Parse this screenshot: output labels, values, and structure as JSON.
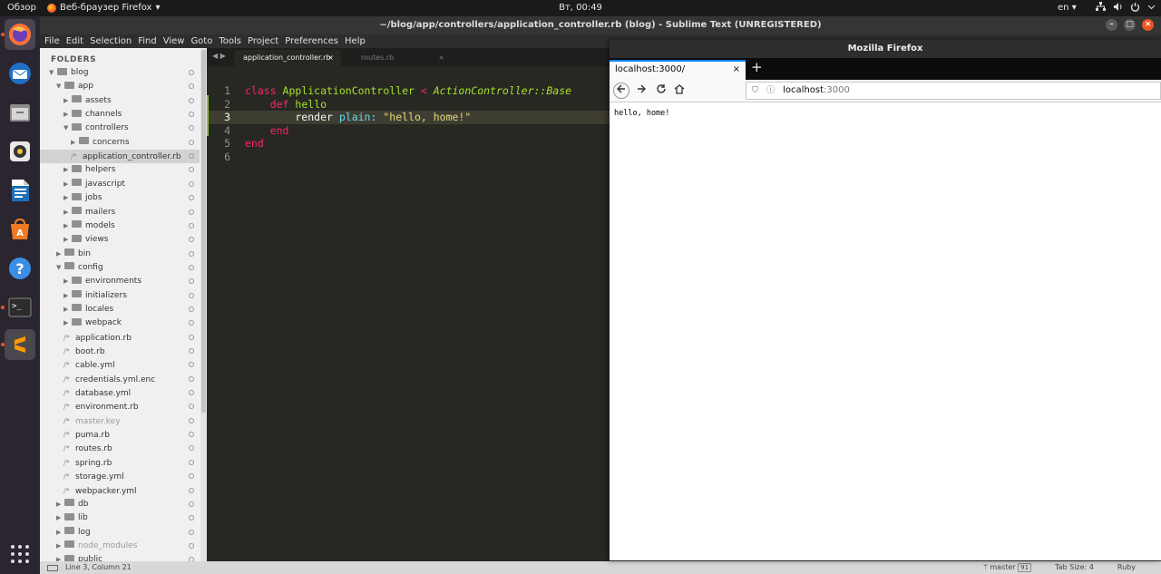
{
  "topbar": {
    "overview": "Обзор",
    "app_label": "Веб-браузер Firefox",
    "app_chevron": "▾",
    "clock": "Вт, 00:49",
    "lang": "en",
    "lang_chevron": "▾",
    "icons": [
      "network-icon",
      "volume-icon",
      "power-icon",
      "chevron-down-icon"
    ]
  },
  "dock": {
    "items": [
      "firefox",
      "thunderbird",
      "files",
      "rhythmbox",
      "libreoffice-writer",
      "ubuntu-software",
      "help",
      "terminal",
      "sublime-text",
      "show-applications"
    ]
  },
  "sublime": {
    "title": "~/blog/app/controllers/application_controller.rb (blog) - Sublime Text (UNREGISTERED)",
    "window_controls": {
      "minimize": "–",
      "maximize": "□",
      "close": "×"
    },
    "menu": [
      "File",
      "Edit",
      "Selection",
      "Find",
      "View",
      "Goto",
      "Tools",
      "Project",
      "Preferences",
      "Help"
    ],
    "sidebar": {
      "header": "FOLDERS",
      "tree": [
        {
          "label": "blog",
          "kind": "folder",
          "open": true,
          "depth": 0
        },
        {
          "label": "app",
          "kind": "folder",
          "open": true,
          "depth": 1
        },
        {
          "label": "assets",
          "kind": "folder",
          "open": false,
          "depth": 2
        },
        {
          "label": "channels",
          "kind": "folder",
          "open": false,
          "depth": 2
        },
        {
          "label": "controllers",
          "kind": "folder",
          "open": true,
          "depth": 2
        },
        {
          "label": "concerns",
          "kind": "folder",
          "open": false,
          "depth": 3
        },
        {
          "label": "application_controller.rb",
          "kind": "file",
          "depth": 3,
          "selected": true
        },
        {
          "label": "helpers",
          "kind": "folder",
          "open": false,
          "depth": 2
        },
        {
          "label": "javascript",
          "kind": "folder",
          "open": false,
          "depth": 2
        },
        {
          "label": "jobs",
          "kind": "folder",
          "open": false,
          "depth": 2
        },
        {
          "label": "mailers",
          "kind": "folder",
          "open": false,
          "depth": 2
        },
        {
          "label": "models",
          "kind": "folder",
          "open": false,
          "depth": 2
        },
        {
          "label": "views",
          "kind": "folder",
          "open": false,
          "depth": 2
        },
        {
          "label": "bin",
          "kind": "folder",
          "open": false,
          "depth": 1
        },
        {
          "label": "config",
          "kind": "folder",
          "open": true,
          "depth": 1
        },
        {
          "label": "environments",
          "kind": "folder",
          "open": false,
          "depth": 2
        },
        {
          "label": "initializers",
          "kind": "folder",
          "open": false,
          "depth": 2
        },
        {
          "label": "locales",
          "kind": "folder",
          "open": false,
          "depth": 2
        },
        {
          "label": "webpack",
          "kind": "folder",
          "open": false,
          "depth": 2
        },
        {
          "label": "application.rb",
          "kind": "file",
          "depth": 2
        },
        {
          "label": "boot.rb",
          "kind": "file",
          "depth": 2
        },
        {
          "label": "cable.yml",
          "kind": "file",
          "depth": 2
        },
        {
          "label": "credentials.yml.enc",
          "kind": "file",
          "depth": 2
        },
        {
          "label": "database.yml",
          "kind": "file",
          "depth": 2
        },
        {
          "label": "environment.rb",
          "kind": "file",
          "depth": 2
        },
        {
          "label": "master.key",
          "kind": "file",
          "depth": 2,
          "dim": true
        },
        {
          "label": "puma.rb",
          "kind": "file",
          "depth": 2
        },
        {
          "label": "routes.rb",
          "kind": "file",
          "depth": 2
        },
        {
          "label": "spring.rb",
          "kind": "file",
          "depth": 2
        },
        {
          "label": "storage.yml",
          "kind": "file",
          "depth": 2
        },
        {
          "label": "webpacker.yml",
          "kind": "file",
          "depth": 2
        },
        {
          "label": "db",
          "kind": "folder",
          "open": false,
          "depth": 1
        },
        {
          "label": "lib",
          "kind": "folder",
          "open": false,
          "depth": 1
        },
        {
          "label": "log",
          "kind": "folder",
          "open": false,
          "depth": 1
        },
        {
          "label": "node_modules",
          "kind": "folder",
          "open": false,
          "depth": 1,
          "dim": true
        },
        {
          "label": "public",
          "kind": "folder",
          "open": false,
          "depth": 1
        }
      ]
    },
    "tabs": [
      {
        "label": "application_controller.rb",
        "active": true
      },
      {
        "label": "routes.rb",
        "active": false
      }
    ],
    "tab_close": "×",
    "editor": {
      "current_line": 3,
      "lines": [
        [
          {
            "t": "class ",
            "c": "kw"
          },
          {
            "t": "ApplicationController",
            "c": "cls"
          },
          {
            "t": " < ",
            "c": "kw"
          },
          {
            "t": "ActionController::Base",
            "c": "inh"
          }
        ],
        [
          {
            "t": "    "
          },
          {
            "t": "def",
            "c": "kw"
          },
          {
            "t": " "
          },
          {
            "t": "hello",
            "c": "cls"
          }
        ],
        [
          {
            "t": "        render "
          },
          {
            "t": "plain:",
            "c": "sym"
          },
          {
            "t": " "
          },
          {
            "t": "\"hello, home!\"",
            "c": "str"
          }
        ],
        [
          {
            "t": "    "
          },
          {
            "t": "end",
            "c": "kw"
          }
        ],
        [
          {
            "t": "end",
            "c": "kw"
          }
        ],
        []
      ]
    },
    "status": {
      "position": "Line 3, Column 21",
      "branch": "master",
      "branch_badge": "91",
      "tab_size": "Tab Size: 4",
      "syntax": "Ruby"
    }
  },
  "firefox": {
    "title": "Mozilla Firefox",
    "tab_label": "localhost:3000/",
    "tab_close": "×",
    "new_tab": "+",
    "url_host": "localhost",
    "url_port": ":3000",
    "page_text": "hello, home!"
  },
  "colors": {
    "accent": "#e95420",
    "firefox_blue": "#0a84ff",
    "monokai_bg": "#272822"
  }
}
